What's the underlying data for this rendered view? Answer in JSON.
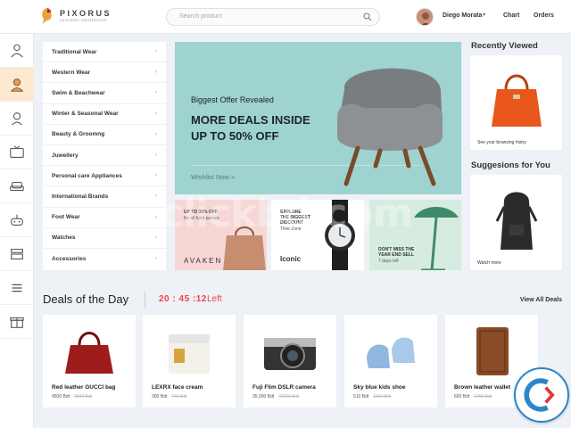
{
  "brand": {
    "name": "PIXORUS",
    "tagline": "customer satisfaction"
  },
  "search": {
    "placeholder": "Search product"
  },
  "user": {
    "name": "Diego Morata"
  },
  "nav": {
    "chart": "Chart",
    "orders": "Orders"
  },
  "rail": {
    "items": [
      {
        "icon": "person-icon",
        "active": false
      },
      {
        "icon": "woman-icon",
        "active": true
      },
      {
        "icon": "child-icon",
        "active": false
      },
      {
        "icon": "tv-icon",
        "active": false
      },
      {
        "icon": "sofa-icon",
        "active": false
      },
      {
        "icon": "gamepad-icon",
        "active": false
      },
      {
        "icon": "furniture-icon",
        "active": false
      },
      {
        "icon": "menu-icon",
        "active": false
      },
      {
        "icon": "gift-icon",
        "active": false
      }
    ]
  },
  "categories": [
    "Traditional Wear",
    "Western Wear",
    "Swim & Beachwear",
    "Winter & Seasonal Wear",
    "Beauty & Groomng",
    "Juwellery",
    "Personal care Appliances",
    "International Brands",
    "Foot Wear",
    "Watches",
    "Accessories"
  ],
  "hero": {
    "subtitle": "Biggest Offer Revealed",
    "title_line1": "MORE DEALS INSIDE",
    "title_line2": "UP TO 50% OFF",
    "link": "Wishlist Now  »"
  },
  "promos": {
    "tile1": {
      "line1": "UP TO 30% OFF",
      "line2": "for all fund purses",
      "brand": "AVAKEN"
    },
    "tile2": {
      "line1": "EXPLORE",
      "line2": "THE BIGGEST",
      "line3": "DISCOUNT",
      "line4": "Time Zone",
      "brand": "Iconic"
    },
    "tile3": {
      "line1": "DON'T MISS THE",
      "line2": "YEAR END SELL",
      "line3": "7 days left"
    }
  },
  "recently_viewed": {
    "title": "Recently Viewed",
    "caption": "See your browsing histry"
  },
  "suggestions": {
    "title": "Suggesions for You",
    "caption": "Watch more"
  },
  "deals": {
    "title": "Deals of the Day",
    "timer": "20 : 45 :12",
    "timer_suffix": "Left",
    "view_all": "View All Deals",
    "products": [
      {
        "name": "Red leather GUCCI bag",
        "price": "4500 Bdt",
        "old": "7500 Bdt"
      },
      {
        "name": "LEXRX face cream",
        "price": "300 Bdt",
        "old": "745 Bdt"
      },
      {
        "name": "Fuji Flim DSLR camera",
        "price": "35,000 Bdt",
        "old": "40000 Bdt"
      },
      {
        "name": "Sky blue kids shoe",
        "price": "510 Bdt",
        "old": "1000 Bdt"
      },
      {
        "name": "Brown leather wallet",
        "price": "600 Bdt",
        "old": "1000 Bdt"
      }
    ]
  },
  "watermark": {
    "text": "clickbd.com"
  },
  "colors": {
    "accent": "#e44444",
    "hero_bg": "#9ed3cf",
    "active_rail": "#fde9cf"
  }
}
